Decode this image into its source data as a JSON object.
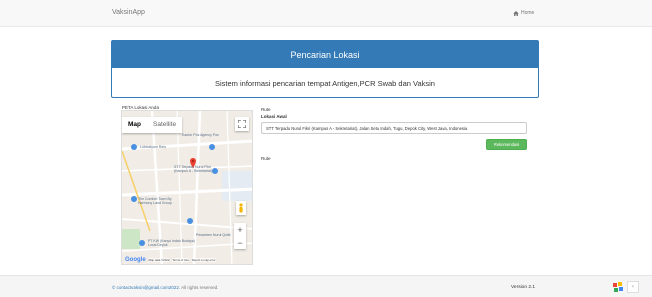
{
  "navbar": {
    "brand": "VaksinApp",
    "home_label": "Home"
  },
  "panel": {
    "heading": "Pencarian Lokasi",
    "body": "Sistem informasi pencarian tempat Antigen,PCR Swab dan Vaksin"
  },
  "map": {
    "title": "PETA Lokasi Anda",
    "type_map": "Map",
    "type_satellite": "Satellite",
    "places": {
      "p1": "Kantor Pos Agency Pos",
      "p2": "Lobicatyum Rets",
      "p3": "STT Terpadu Nurul Fikri (Kampus A - Sekretariat)",
      "p4": "The Comfort Town By Harmony Land Group",
      "p5": "Pesantren Nurul Qolbi",
      "p6": "PT KW (Kanyo Indah Budaya) Local Depok"
    },
    "footer": {
      "logo": "Google",
      "map_data": "Map data ©2022",
      "terms": "Terms of Use",
      "report": "Report a map error"
    }
  },
  "form": {
    "rute_label": "Rute",
    "lokasi_label": "Lokasi Awal",
    "lokasi_value": "STT Terpadu Nurul Fikri (Kampus A - Sekretariat), Jalan Setu Indah, Tugu, Depok City, West Java, Indonesia",
    "button_label": "Rekomendasi",
    "rute_label_2": "Rute"
  },
  "footer": {
    "email": "© contactvaksin@gmail.com2022.",
    "rights": " All rights reserved.",
    "version": "Version 2.1"
  },
  "colors": {
    "primary": "#337ab7",
    "success": "#5cb85c"
  }
}
